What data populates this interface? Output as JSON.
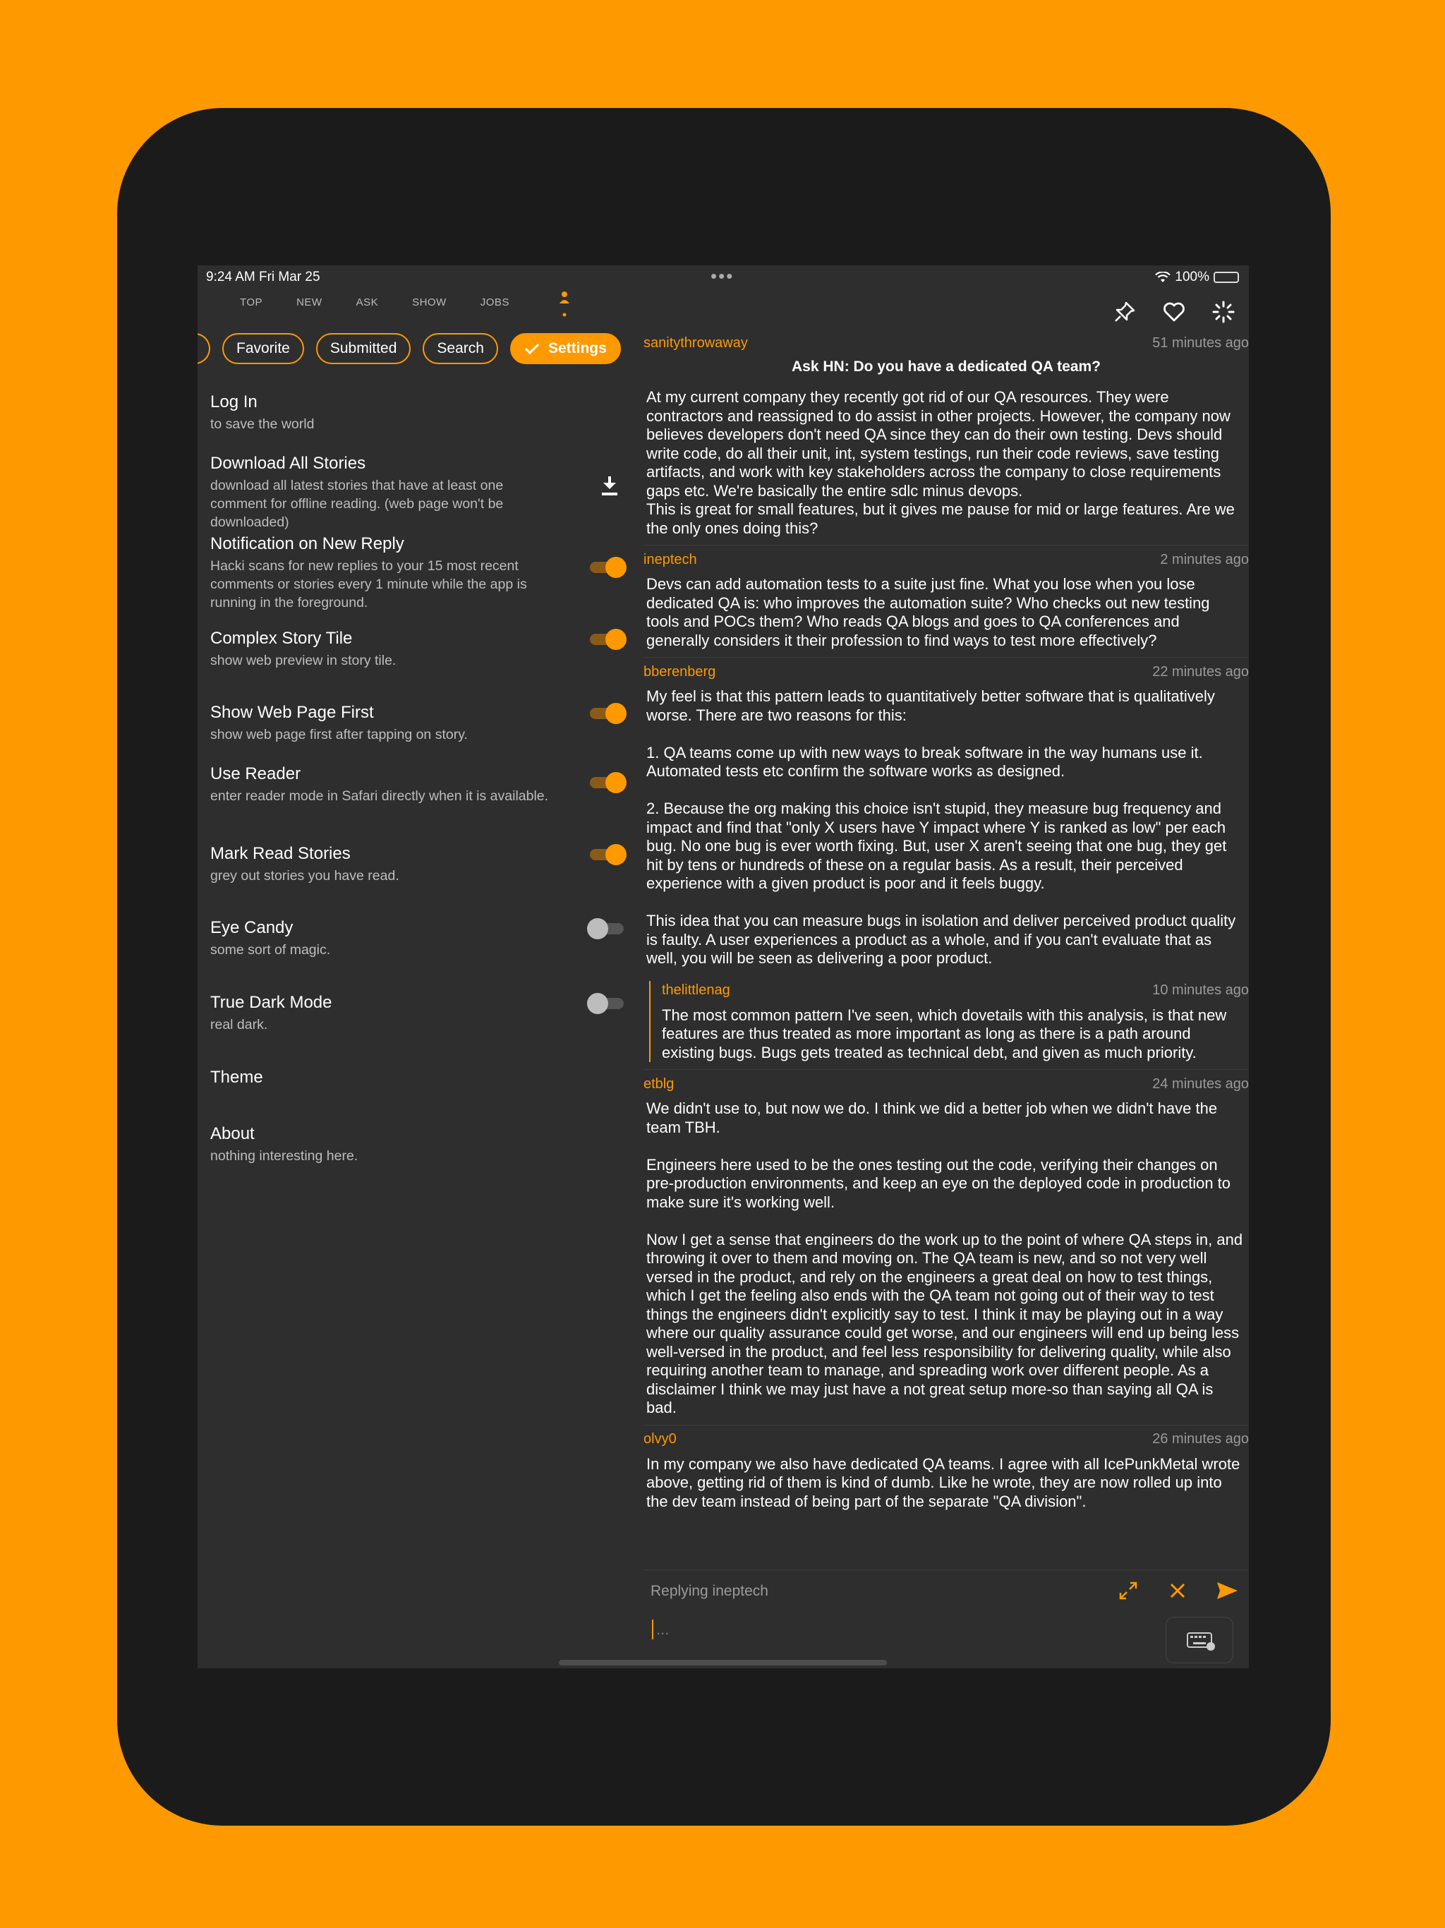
{
  "status": {
    "time": "9:24 AM   Fri Mar 25",
    "battery": "100%"
  },
  "tabs": [
    "TOP",
    "NEW",
    "ASK",
    "SHOW",
    "JOBS"
  ],
  "chips": {
    "favorite": "Favorite",
    "submitted": "Submitted",
    "search": "Search",
    "settings": "Settings"
  },
  "settings": [
    {
      "title": "Log In",
      "subtitle": "to save the world"
    },
    {
      "title": "Download All Stories",
      "subtitle": "download all latest stories that have at least one comment for offline reading. (web page won't be downloaded)"
    },
    {
      "title": "Notification on New Reply",
      "subtitle": "Hacki scans for new replies to your 15 most recent comments or stories every 1 minute while the app is running in the foreground.",
      "on": true
    },
    {
      "title": "Complex Story Tile",
      "subtitle": "show web preview in story tile.",
      "on": true
    },
    {
      "title": "Show Web Page First",
      "subtitle": "show web page first after tapping on story.",
      "on": true
    },
    {
      "title": "Use Reader",
      "subtitle": "enter reader mode in Safari directly when it is available.",
      "on": true
    },
    {
      "title": "Mark Read Stories",
      "subtitle": "grey out stories you have read.",
      "on": true
    },
    {
      "title": "Eye Candy",
      "subtitle": "some sort of magic.",
      "on": false
    },
    {
      "title": "True Dark Mode",
      "subtitle": "real dark.",
      "on": false
    },
    {
      "title": "Theme",
      "subtitle": ""
    },
    {
      "title": "About",
      "subtitle": "nothing interesting here."
    }
  ],
  "story": {
    "author": "sanitythrowaway",
    "time": "51 minutes ago",
    "title": "Ask HN: Do you have a dedicated QA team?",
    "text": "At my current company they recently got rid of our QA resources. They were contractors and reassigned to do assist in other projects. However, the company now believes developers don't need QA since they can do their own testing. Devs should write code, do all their unit, int, system testings, run their code reviews, save testing artifacts, and work with key stakeholders across the company to close requirements gaps etc. We're basically the entire sdlc minus devops.\nThis is great for small features, but it gives me pause for mid or large features. Are we the only ones doing this?"
  },
  "comments": [
    {
      "author": "ineptech",
      "time": "2 minutes ago",
      "text": "Devs can add automation tests to a suite just fine.  What you lose when you lose dedicated QA is: who improves the automation suite?  Who checks out new testing tools and POCs them?  Who reads QA blogs and goes to QA conferences and generally considers it their profession to find ways to test more effectively?"
    },
    {
      "author": "bberenberg",
      "time": "22 minutes ago",
      "text": "My feel is that this pattern leads to quantitatively better software that is qualitatively worse. There are two reasons for this:\n\n1. QA teams come up with new ways to break software in the way humans use it. Automated tests etc confirm the software works as designed.\n\n2. Because the org making this choice isn't stupid, they measure bug frequency and impact and find that \"only X users have Y impact where Y is ranked as low\" per each bug. No one bug is ever worth fixing. But, user X aren't seeing that one bug, they get hit by tens or hundreds of these on a regular basis. As a result, their perceived experience with a given product is poor and it feels buggy.\n\nThis idea that you can measure bugs in isolation and deliver perceived product quality is faulty. A user experiences a product as a whole, and if you can't evaluate that as well, you will be seen as delivering a poor product."
    },
    {
      "author": "thelittlenag",
      "time": "10 minutes ago",
      "nested": true,
      "text": "The most common pattern I've seen, which dovetails with this analysis, is that new features are thus treated as more important as long as there is a path around existing bugs. Bugs gets treated as technical debt, and given as much priority."
    },
    {
      "author": "etblg",
      "time": "24 minutes ago",
      "text": "We didn't use to, but now we do. I think we did a better job when we didn't have the team TBH.\n\nEngineers here used to be the ones testing out the code, verifying their changes on pre-production environments, and keep an eye on the deployed code in production to make sure it's working well.\n\nNow I get a sense that engineers do the work up to the point of where QA steps in, and throwing it over to them and moving on. The QA team is new, and so not very well versed in the product, and rely on the engineers a great deal on how to test things, which I get the feeling also ends with the QA team not going out of their way to test things the engineers didn't explicitly say to test. I think it may be playing out in a way where our quality assurance could get worse, and our engineers will end up being less well-versed in the product, and feel less responsibility for delivering quality, while also requiring another team to manage, and spreading work over different people. As a disclaimer I think we may just have a not great setup more-so than saying all QA is bad."
    },
    {
      "author": "olvy0",
      "time": "26 minutes ago",
      "text": "In my company we also have dedicated QA teams.  I agree with all IcePunkMetal wrote above, getting rid of them is kind of dumb.  Like he wrote, they are now rolled up into the dev team instead of being part of the separate \"QA division\"."
    }
  ],
  "reply": {
    "label": "Replying ineptech",
    "placeholder": "..."
  },
  "colors": {
    "accent": "#FF9900",
    "panel": "#2e2e2e",
    "device": "#1b1b1b"
  }
}
